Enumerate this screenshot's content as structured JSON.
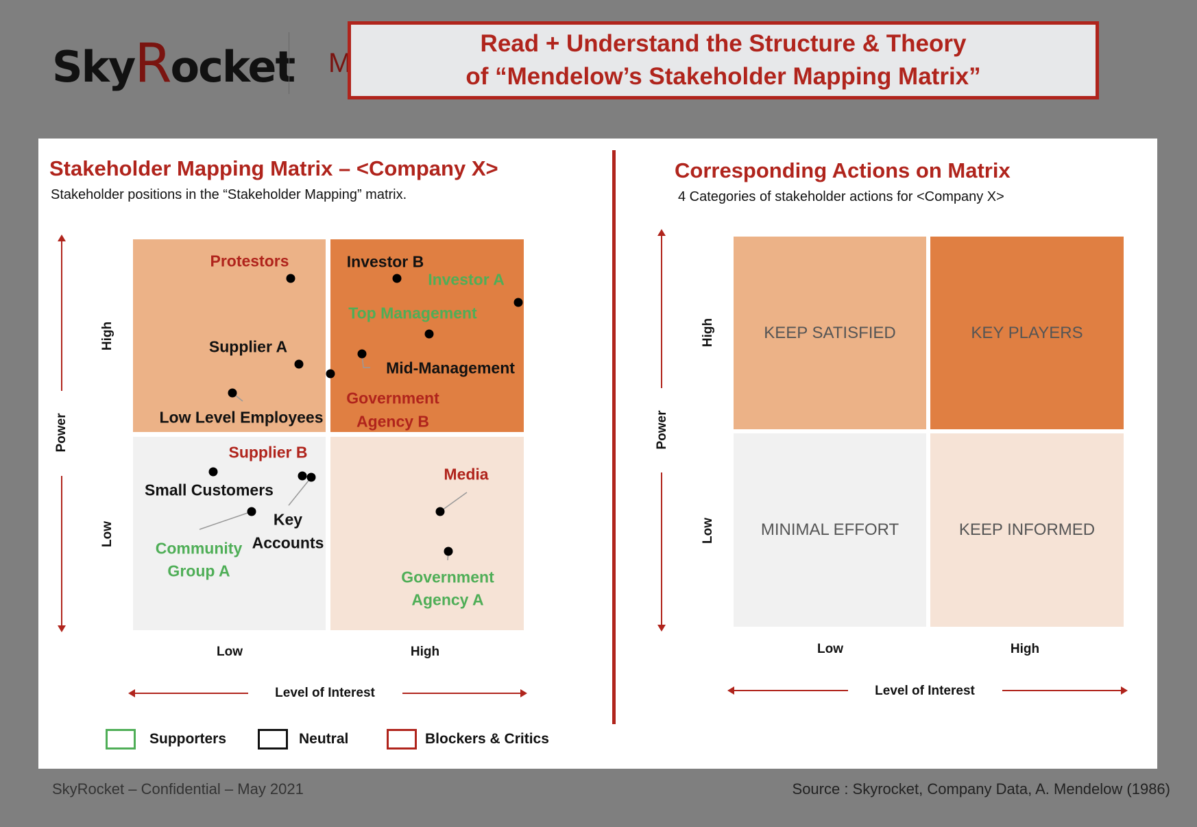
{
  "header": {
    "logo_text": "SkyRocket",
    "partial_letter": "M",
    "title_line1": "Read + Understand the Structure & Theory",
    "title_line2": "of “Mendelow’s Stakeholder Mapping Matrix”"
  },
  "left": {
    "title": "Stakeholder Mapping Matrix – <Company X>",
    "subtitle": "Stakeholder positions in the “Stakeholder Mapping” matrix.",
    "y_axis": "Power",
    "y_high": "High",
    "y_low": "Low",
    "x_low": "Low",
    "x_high": "High",
    "x_axis": "Level of Interest",
    "stakeholders": [
      {
        "name": "Protestors",
        "type": "blocker"
      },
      {
        "name": "Investor B",
        "type": "neutral"
      },
      {
        "name": "Investor A",
        "type": "supporter"
      },
      {
        "name": "Top Management",
        "type": "supporter"
      },
      {
        "name": "Supplier A",
        "type": "neutral"
      },
      {
        "name": "Mid-Management",
        "type": "neutral"
      },
      {
        "name": "Government",
        "type": "blocker"
      },
      {
        "name": "Agency B",
        "type": "blocker"
      },
      {
        "name": "Low Level Employees",
        "type": "neutral"
      },
      {
        "name": "Supplier B",
        "type": "blocker"
      },
      {
        "name": "Small Customers",
        "type": "neutral"
      },
      {
        "name": "Key",
        "type": "neutral"
      },
      {
        "name": "Accounts",
        "type": "neutral"
      },
      {
        "name": "Community",
        "type": "supporter"
      },
      {
        "name": "Group A",
        "type": "supporter"
      },
      {
        "name": "Media",
        "type": "blocker"
      },
      {
        "name": "Government",
        "type": "supporter"
      },
      {
        "name": "Agency A",
        "type": "supporter"
      }
    ]
  },
  "legend": [
    {
      "label": "Supporters",
      "color": "#4fae57"
    },
    {
      "label": "Neutral",
      "color": "#111111"
    },
    {
      "label": "Blockers & Critics",
      "color": "#b0241c"
    }
  ],
  "right": {
    "title": "Corresponding Actions on Matrix",
    "subtitle": "4 Categories of stakeholder actions for <Company X>",
    "y_axis": "Power",
    "y_high": "High",
    "y_low": "Low",
    "x_low": "Low",
    "x_high": "High",
    "x_axis": "Level of Interest",
    "quadrants": {
      "keep_satisfied": "KEEP SATISFIED",
      "key_players": "KEY PLAYERS",
      "minimal_effort": "MINIMAL EFFORT",
      "keep_informed": "KEEP INFORMED"
    }
  },
  "footer": {
    "left": "SkyRocket – Confidential – May 2021",
    "right": "Source : Skyrocket, Company Data, A. Mendelow (1986)"
  },
  "colors": {
    "accent": "#b0241c",
    "supporter": "#4fae57",
    "tl": "#ecb287",
    "tr": "#e07f42",
    "bl": "#f1f1f1",
    "br": "#f6e3d6"
  }
}
